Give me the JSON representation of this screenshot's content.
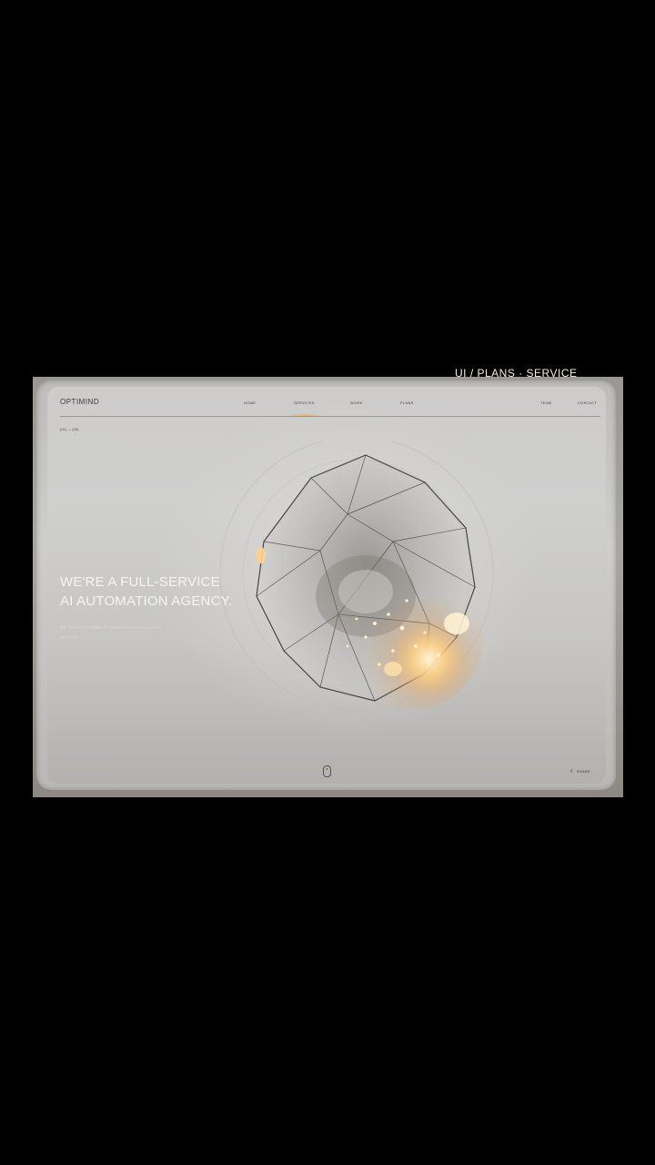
{
  "app": {
    "logo": "OPTIMIND"
  },
  "nav": {
    "items": [
      "HOME",
      "SERVICES",
      "WORK",
      "PLANS",
      "TEAM",
      "CONTACT"
    ]
  },
  "hero": {
    "tag": "(01) — (05)",
    "line1": "WE'RE A FULL-SERVICE",
    "line2": "AI AUTOMATION AGENCY.",
    "subtitle": "We deliver incredible AI automation services under one roof."
  },
  "footer": {
    "share_label": "SHARE"
  },
  "overlay": {
    "corner_text": "UI / PLANS · SERVICE"
  },
  "colors": {
    "background": "#000000",
    "page": "#cdcccb",
    "accent_glow": "#f0b464",
    "hero_text": "#f6f5f3"
  },
  "icons": {
    "mouse": "mouse-scroll-icon",
    "share": "share-icon"
  }
}
